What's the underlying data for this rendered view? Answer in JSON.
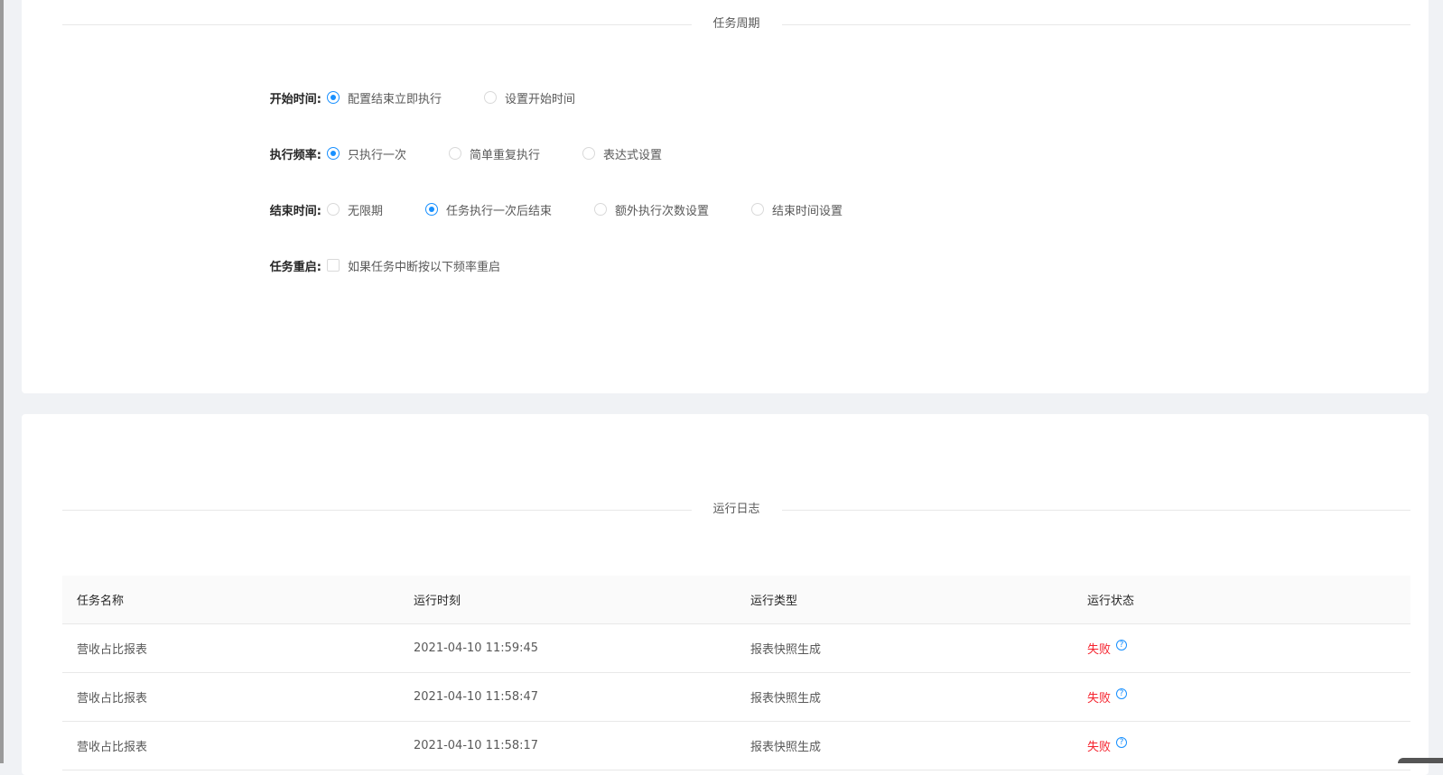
{
  "schedule_section": {
    "title": "任务周期",
    "start_time": {
      "label": "开始时间:",
      "options": [
        "配置结束立即执行",
        "设置开始时间"
      ],
      "selected": "配置结束立即执行"
    },
    "frequency": {
      "label": "执行频率:",
      "options": [
        "只执行一次",
        "简单重复执行",
        "表达式设置"
      ],
      "selected": "只执行一次"
    },
    "end_time": {
      "label": "结束时间:",
      "options": [
        "无限期",
        "任务执行一次后结束",
        "额外执行次数设置",
        "结束时间设置"
      ],
      "selected": "任务执行一次后结束"
    },
    "restart": {
      "label": "任务重启:",
      "checkbox_label": "如果任务中断按以下频率重启",
      "checked": false
    }
  },
  "log_section": {
    "title": "运行日志",
    "columns": [
      "任务名称",
      "运行时刻",
      "运行类型",
      "运行状态"
    ],
    "rows": [
      {
        "name": "营收占比报表",
        "time": "2021-04-10 11:59:45",
        "type": "报表快照生成",
        "status": "失败"
      },
      {
        "name": "营收占比报表",
        "time": "2021-04-10 11:58:47",
        "type": "报表快照生成",
        "status": "失败"
      },
      {
        "name": "营收占比报表",
        "time": "2021-04-10 11:58:17",
        "type": "报表快照生成",
        "status": "失败"
      }
    ],
    "help_icon": "question-circle-icon",
    "status_color": "#f5222d",
    "accent_color": "#1890ff"
  }
}
